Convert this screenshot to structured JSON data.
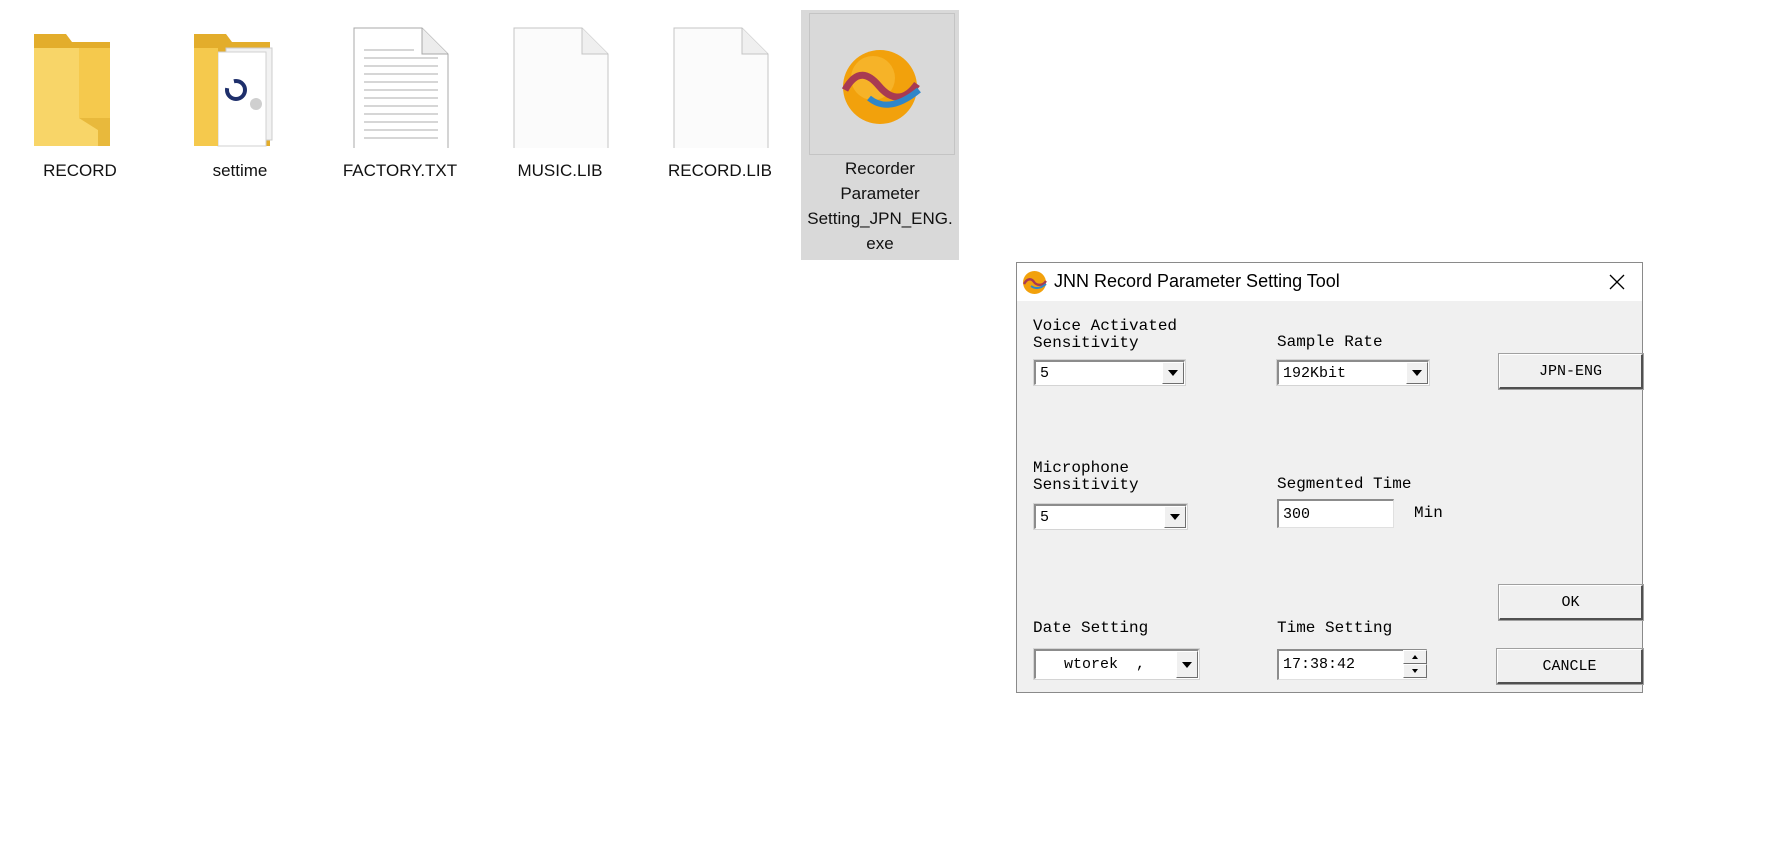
{
  "desktop": {
    "files": [
      {
        "name": "RECORD",
        "icon": "folder-icon"
      },
      {
        "name": "settime",
        "icon": "folder-with-files-icon"
      },
      {
        "name": "FACTORY.TXT",
        "icon": "text-file-icon"
      },
      {
        "name": "MUSIC.LIB",
        "icon": "blank-file-icon"
      },
      {
        "name": "RECORD.LIB",
        "icon": "blank-file-icon"
      },
      {
        "name": "Recorder Parameter Setting_JPN_ENG.exe",
        "icon": "app-icon",
        "selected": true
      }
    ]
  },
  "dialog": {
    "title": "JNN Record Parameter Setting Tool",
    "voice_activated_label": "Voice Activated\nSensitivity",
    "voice_activated_value": "5",
    "sample_rate_label": "Sample Rate",
    "sample_rate_value": "192Kbit",
    "lang_button": "JPN-ENG",
    "microphone_label": "Microphone\nSensitivity",
    "microphone_value": "5",
    "segmented_time_label": "Segmented Time",
    "segmented_time_value": "300",
    "segmented_time_unit": "Min",
    "date_label": "Date Setting",
    "date_value": "wtorek  ,",
    "time_label": "Time Setting",
    "time_value": "17:38:42",
    "ok_button": "OK",
    "cancel_button": "CANCLE"
  },
  "colors": {
    "folder": "#f5c94d",
    "folder_dark": "#e3ad2b",
    "selection": "#d9d9d9",
    "dialog_bg": "#f0f0f0",
    "app_orange": "#f2a10c",
    "app_wave_red": "#a83a52",
    "app_wave_blue": "#2f86c9"
  }
}
